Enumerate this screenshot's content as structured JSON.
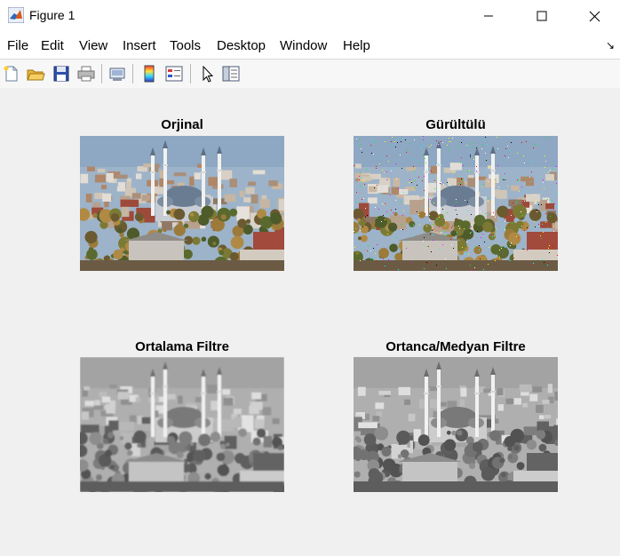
{
  "window": {
    "title": "Figure 1"
  },
  "menu": [
    "File",
    "Edit",
    "View",
    "Insert",
    "Tools",
    "Desktop",
    "Window",
    "Help"
  ],
  "toolbar_icons": [
    "new-figure-icon",
    "open-file-icon",
    "save-icon",
    "print-icon",
    "link-plot-icon",
    "colorbar-icon",
    "legend-icon",
    "pointer-icon",
    "property-editor-icon"
  ],
  "panels": [
    {
      "title": "Orjinal",
      "style": "color"
    },
    {
      "title": "Gürültülü",
      "style": "noisy"
    },
    {
      "title": "Ortalama Filtre",
      "style": "gray-blur"
    },
    {
      "title": "Ortanca/Medyan Filtre",
      "style": "gray"
    }
  ]
}
